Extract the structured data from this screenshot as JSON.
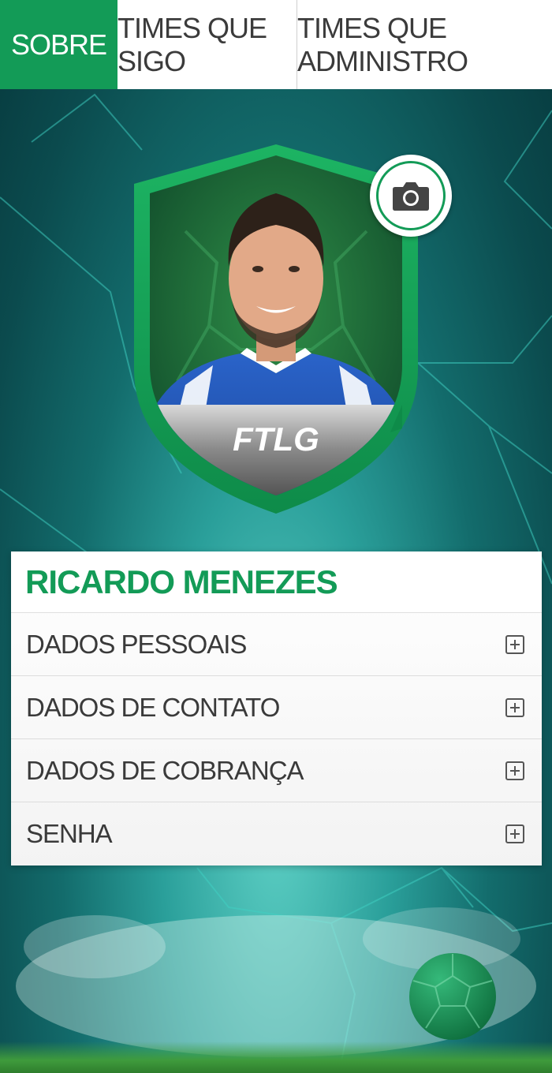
{
  "tabs": [
    {
      "label": "SOBRE",
      "active": true
    },
    {
      "label": "TIMES QUE SIGO",
      "active": false
    },
    {
      "label": "TIMES QUE ADMINISTRO",
      "active": false
    }
  ],
  "badge": {
    "brand": "FTLG"
  },
  "camera": {
    "icon": "camera-icon"
  },
  "profile": {
    "name": "RICARDO MENEZES",
    "sections": [
      {
        "label": "DADOS PESSOAIS",
        "icon": "plus-square-icon"
      },
      {
        "label": "DADOS DE CONTATO",
        "icon": "plus-square-icon"
      },
      {
        "label": "DADOS DE COBRANÇA",
        "icon": "plus-square-icon"
      },
      {
        "label": "SENHA",
        "icon": "plus-square-icon"
      }
    ]
  },
  "colors": {
    "accent": "#139b57",
    "background": "#136c6c"
  }
}
